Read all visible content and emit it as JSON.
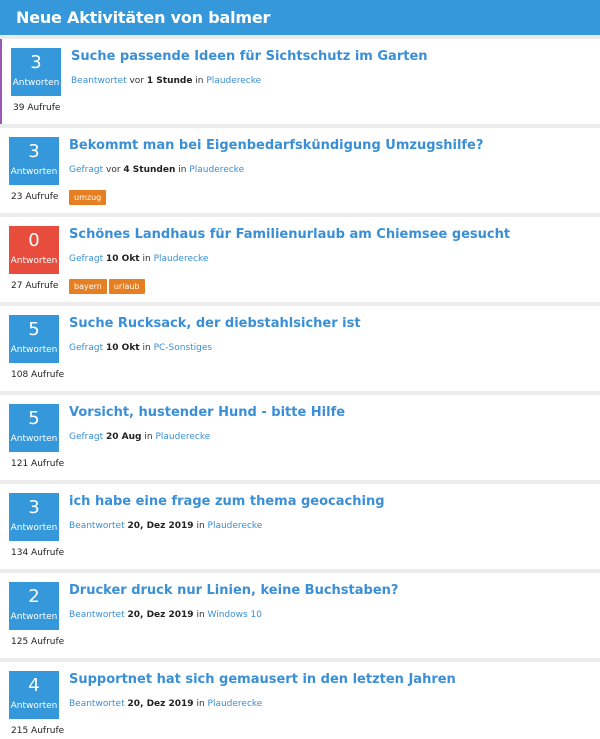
{
  "header": {
    "title": "Neue Aktivitäten von balmer"
  },
  "items": [
    {
      "count": "3",
      "count_label": "Antworten",
      "views": "39 Aufrufe",
      "title": "Suche passende Ideen für Sichtschutz im Garten",
      "action": "Beantwortet",
      "time_prefix": " vor ",
      "time": "1 Stunde",
      "in_text": " in ",
      "category": "Plauderecke",
      "tags": [],
      "red": false
    },
    {
      "count": "3",
      "count_label": "Antworten",
      "views": "23 Aufrufe",
      "title": "Bekommt man bei Eigenbedarfskündigung Umzugshilfe?",
      "action": "Gefragt",
      "time_prefix": " vor ",
      "time": "4 Stunden",
      "in_text": " in ",
      "category": "Plauderecke",
      "tags": [
        "umzug"
      ],
      "red": false
    },
    {
      "count": "0",
      "count_label": "Antworten",
      "views": "27 Aufrufe",
      "title": "Schönes Landhaus für Familienurlaub am Chiemsee gesucht",
      "action": "Gefragt",
      "time_prefix": " ",
      "time": "10 Okt",
      "in_text": " in ",
      "category": "Plauderecke",
      "tags": [
        "bayern",
        "urlaub"
      ],
      "red": true
    },
    {
      "count": "5",
      "count_label": "Antworten",
      "views": "108 Aufrufe",
      "title": "Suche Rucksack, der diebstahlsicher ist",
      "action": "Gefragt",
      "time_prefix": " ",
      "time": "10 Okt",
      "in_text": " in ",
      "category": "PC-Sonstiges",
      "tags": [],
      "red": false
    },
    {
      "count": "5",
      "count_label": "Antworten",
      "views": "121 Aufrufe",
      "title": "Vorsicht, hustender Hund - bitte Hilfe",
      "action": "Gefragt",
      "time_prefix": " ",
      "time": "20 Aug",
      "in_text": " in ",
      "category": "Plauderecke",
      "tags": [],
      "red": false
    },
    {
      "count": "3",
      "count_label": "Antworten",
      "views": "134 Aufrufe",
      "title": "ich habe eine frage zum thema geocaching",
      "action": "Beantwortet",
      "time_prefix": " ",
      "time": "20, Dez 2019",
      "in_text": " in ",
      "category": "Plauderecke",
      "tags": [],
      "red": false
    },
    {
      "count": "2",
      "count_label": "Antworten",
      "views": "125 Aufrufe",
      "title": "Drucker druck nur Linien, keine Buchstaben?",
      "action": "Beantwortet",
      "time_prefix": " ",
      "time": "20, Dez 2019",
      "in_text": " in ",
      "category": "Windows 10",
      "tags": [],
      "red": false
    },
    {
      "count": "4",
      "count_label": "Antworten",
      "views": "215 Aufrufe",
      "title": "Supportnet hat sich gemausert in den letzten Jahren",
      "action": "Beantwortet",
      "time_prefix": " ",
      "time": "20, Dez 2019",
      "in_text": " in ",
      "category": "Plauderecke",
      "tags": [],
      "red": false
    }
  ],
  "colors": {
    "accent": "#3498db",
    "red": "#e74c3c",
    "tag": "#e67e22",
    "highlight_border": "#9b59b6"
  }
}
